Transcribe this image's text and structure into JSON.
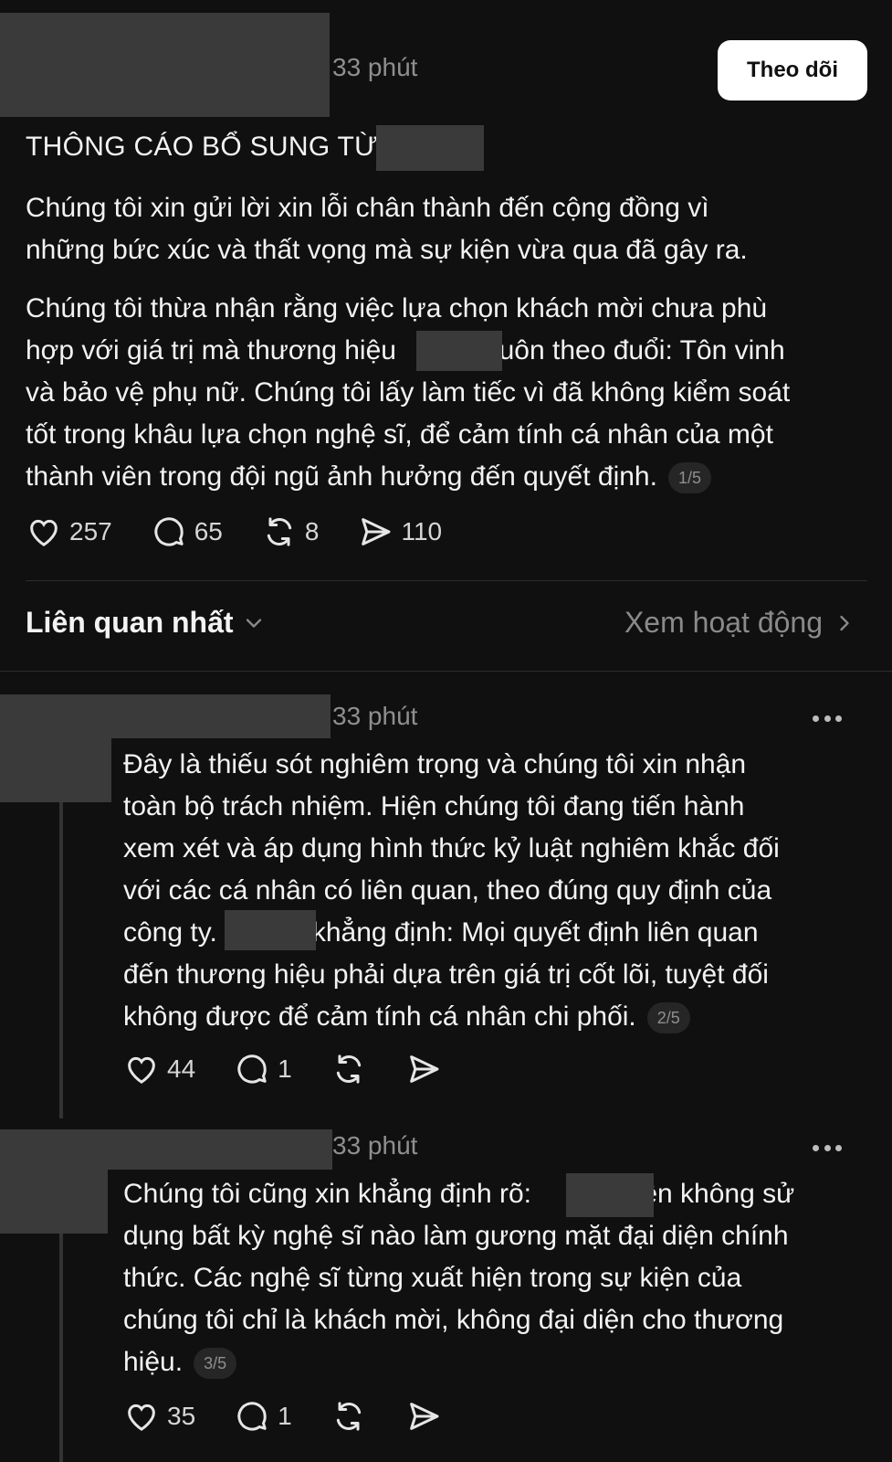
{
  "post": {
    "time": "33 phút",
    "follow_label": "Theo dõi",
    "headline": "THÔNG CÁO BỔ SUNG TỪ",
    "p1_line1": "Chúng tôi xin gửi lời xin lỗi chân thành đến cộng đồng vì",
    "p1_line2": "những bức xúc và thất vọng mà sự kiện vừa qua đã gây ra.",
    "p2_line1": "Chúng tôi thừa nhận rằng việc lựa chọn khách mời chưa phù",
    "p2_line2a": "hợp với giá trị mà thương hiệu",
    "p2_line2b": "luôn theo đuổi: Tôn vinh",
    "p2_line3": "và bảo vệ phụ nữ. Chúng tôi lấy làm tiếc vì đã không kiểm soát",
    "p2_line4": "tốt trong khâu lựa chọn nghệ sĩ, để cảm tính cá nhân của một",
    "p2_line5": "thành viên trong đội ngũ ảnh hưởng đến quyết định.",
    "pager": "1/5",
    "likes": "257",
    "comments": "65",
    "reposts": "8",
    "shares": "110"
  },
  "sort": {
    "label": "Liên quan nhất",
    "activity_label": "Xem hoạt động"
  },
  "replies": [
    {
      "time": "33 phút",
      "line1": "Đây là thiếu sót nghiêm trọng và chúng tôi xin nhận",
      "line2": "toàn bộ trách nhiệm. Hiện chúng tôi đang tiến hành",
      "line3": "xem xét và áp dụng hình thức kỷ luật nghiêm khắc đối",
      "line4": "với các cá nhân có liên quan, theo đúng quy định của",
      "line5a": "công ty.",
      "line5b": "khẳng định: Mọi quyết định liên quan",
      "line6": "đến thương hiệu phải dựa trên giá trị cốt lõi, tuyệt đối",
      "line7": "không được để cảm tính cá nhân chi phối.",
      "pager": "2/5",
      "likes": "44",
      "comments": "1"
    },
    {
      "time": "33 phút",
      "line1a": "Chúng tôi cũng xin khẳng định rõ:",
      "line1b": "hiện không sử",
      "line2": "dụng bất kỳ nghệ sĩ nào làm gương mặt đại diện chính",
      "line3": "thức. Các nghệ sĩ từng xuất hiện trong sự kiện của",
      "line4": "chúng tôi chỉ là khách mời, không đại diện cho thương",
      "line5": "hiệu.",
      "pager": "3/5",
      "likes": "35",
      "comments": "1"
    }
  ],
  "icons": [
    "heart-icon",
    "comment-icon",
    "repost-icon",
    "share-icon",
    "chevron-down-icon",
    "chevron-right-icon",
    "more-icon"
  ]
}
